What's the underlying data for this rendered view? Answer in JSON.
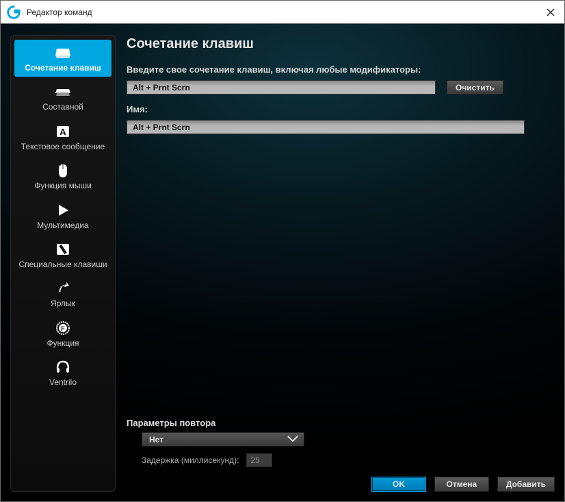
{
  "window_title": "Редактор команд",
  "sidebar": {
    "items": [
      {
        "label": "Сочетание клавиш",
        "icon": "keyboard"
      },
      {
        "label": "Составной",
        "icon": "layers"
      },
      {
        "label": "Текстовое сообщение",
        "icon": "textblock"
      },
      {
        "label": "Функция мыши",
        "icon": "mouse"
      },
      {
        "label": "Мультимедиа",
        "icon": "play"
      },
      {
        "label": "Специальные клавиши",
        "icon": "specialkey"
      },
      {
        "label": "Ярлык",
        "icon": "shortcut"
      },
      {
        "label": "Функция",
        "icon": "gear-f"
      },
      {
        "label": "Ventrilo",
        "icon": "headset"
      }
    ],
    "active_index": 0
  },
  "main": {
    "heading": "Сочетание клавиш",
    "prompt": "Введите свое сочетание клавиш, включая любые модификаторы:",
    "keystroke_value": "Alt + Prnt Scrn",
    "clear_btn": "Очистить",
    "name_label": "Имя:",
    "name_value": "Alt + Prnt Scrn",
    "repeat": {
      "title": "Параметры повтора",
      "dropdown_value": "Нет",
      "delay_label": "Задержка (миллисекунд):",
      "delay_value": "25"
    }
  },
  "footer": {
    "ok": "OK",
    "cancel": "Отмена",
    "add": "Добавить"
  }
}
